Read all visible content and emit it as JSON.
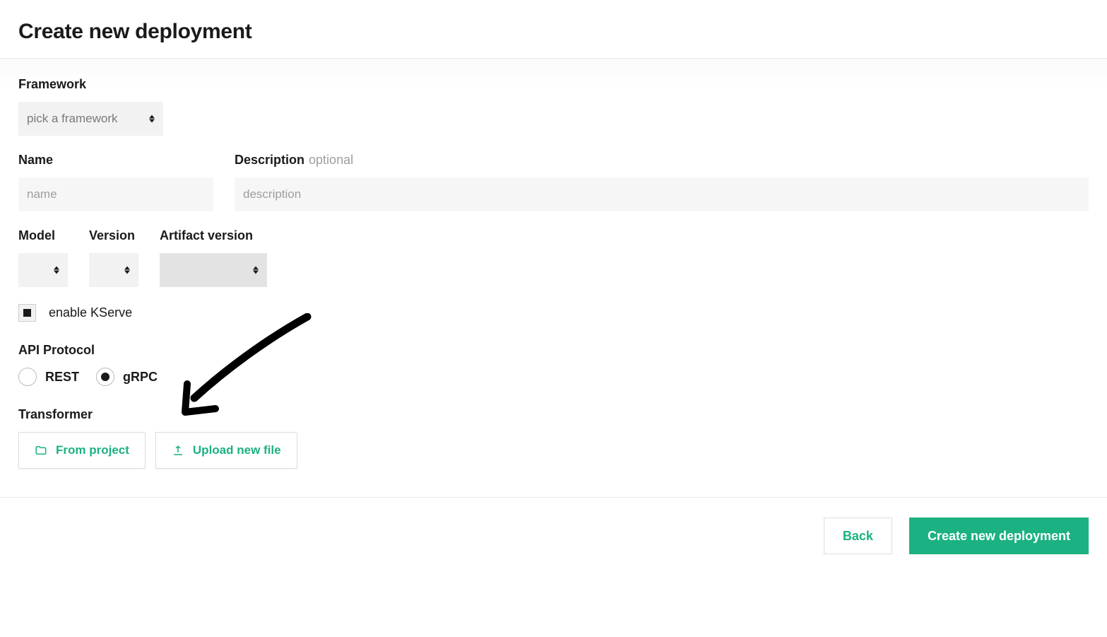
{
  "page_title": "Create new deployment",
  "framework": {
    "label": "Framework",
    "placeholder": "pick a framework"
  },
  "name": {
    "label": "Name",
    "placeholder": "name"
  },
  "description": {
    "label": "Description",
    "optional_text": "optional",
    "placeholder": "description"
  },
  "model": {
    "label": "Model"
  },
  "version": {
    "label": "Version"
  },
  "artifact_version": {
    "label": "Artifact version"
  },
  "kserve": {
    "label": "enable KServe",
    "checked": true
  },
  "api_protocol": {
    "label": "API Protocol",
    "options": {
      "rest": "REST",
      "grpc": "gRPC"
    },
    "selected": "grpc"
  },
  "transformer": {
    "label": "Transformer",
    "from_project": "From project",
    "upload": "Upload new file"
  },
  "footer": {
    "back": "Back",
    "submit": "Create new deployment"
  },
  "colors": {
    "accent": "#1cb182"
  }
}
